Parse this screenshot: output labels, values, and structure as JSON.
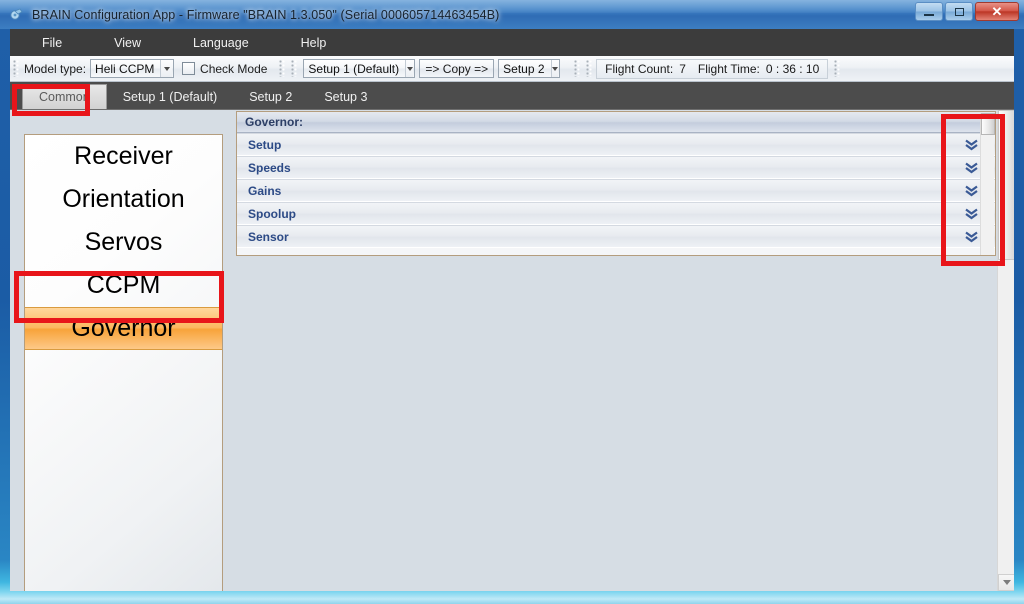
{
  "window": {
    "title": "BRAIN Configuration App - Firmware \"BRAIN 1.3.050\" (Serial 000605714463454B)",
    "app_icon": "app-icon",
    "buttons": {
      "minimize": "minimize-icon",
      "maximize": "maximize-icon",
      "close": "✕"
    }
  },
  "menubar": {
    "items": [
      {
        "label": "File"
      },
      {
        "label": "View"
      },
      {
        "label": "Language"
      },
      {
        "label": "Help"
      }
    ]
  },
  "toolbar": {
    "model_type_label": "Model type:",
    "model_type_value": "Heli CCPM",
    "check_mode_label": "Check Mode",
    "check_mode_checked": false,
    "setup_source_value": "Setup 1 (Default)",
    "copy_button_label": "=> Copy =>",
    "setup_target_value": "Setup 2",
    "flight_count_label": "Flight Count:",
    "flight_count_value": "7",
    "flight_time_label": "Flight Time:",
    "flight_time_value": "0 : 36 : 10"
  },
  "tabs": {
    "items": [
      {
        "label": "Common",
        "active": true
      },
      {
        "label": "Setup 1 (Default)",
        "active": false
      },
      {
        "label": "Setup 2",
        "active": false
      },
      {
        "label": "Setup 3",
        "active": false
      }
    ]
  },
  "sidebar": {
    "items": [
      {
        "label": "Receiver",
        "selected": false
      },
      {
        "label": "Orientation",
        "selected": false
      },
      {
        "label": "Servos",
        "selected": false
      },
      {
        "label": "CCPM",
        "selected": false
      },
      {
        "label": "Governor",
        "selected": true
      }
    ]
  },
  "panel": {
    "header": "Governor:",
    "sections": [
      {
        "label": "Setup",
        "expand_icon": "double-chevron-down-icon"
      },
      {
        "label": "Speeds",
        "expand_icon": "double-chevron-down-icon"
      },
      {
        "label": "Gains",
        "expand_icon": "double-chevron-down-icon"
      },
      {
        "label": "Spoolup",
        "expand_icon": "double-chevron-down-icon"
      },
      {
        "label": "Sensor",
        "expand_icon": "double-chevron-down-icon"
      }
    ]
  },
  "annotations": [
    {
      "name": "common-tab-highlight",
      "color": "#e8151a"
    },
    {
      "name": "governor-item-highlight",
      "color": "#e8151a"
    },
    {
      "name": "expanders-highlight",
      "color": "#e8151a"
    }
  ],
  "colors": {
    "annotation_red": "#e8151a",
    "selected_item_orange": "#f8a33a",
    "menubar_dark": "#3c3c3c",
    "tabstrip_dark": "#4c4c4c",
    "section_link_blue": "#2c4a86",
    "titlebar_blue": "#3e81c6"
  }
}
